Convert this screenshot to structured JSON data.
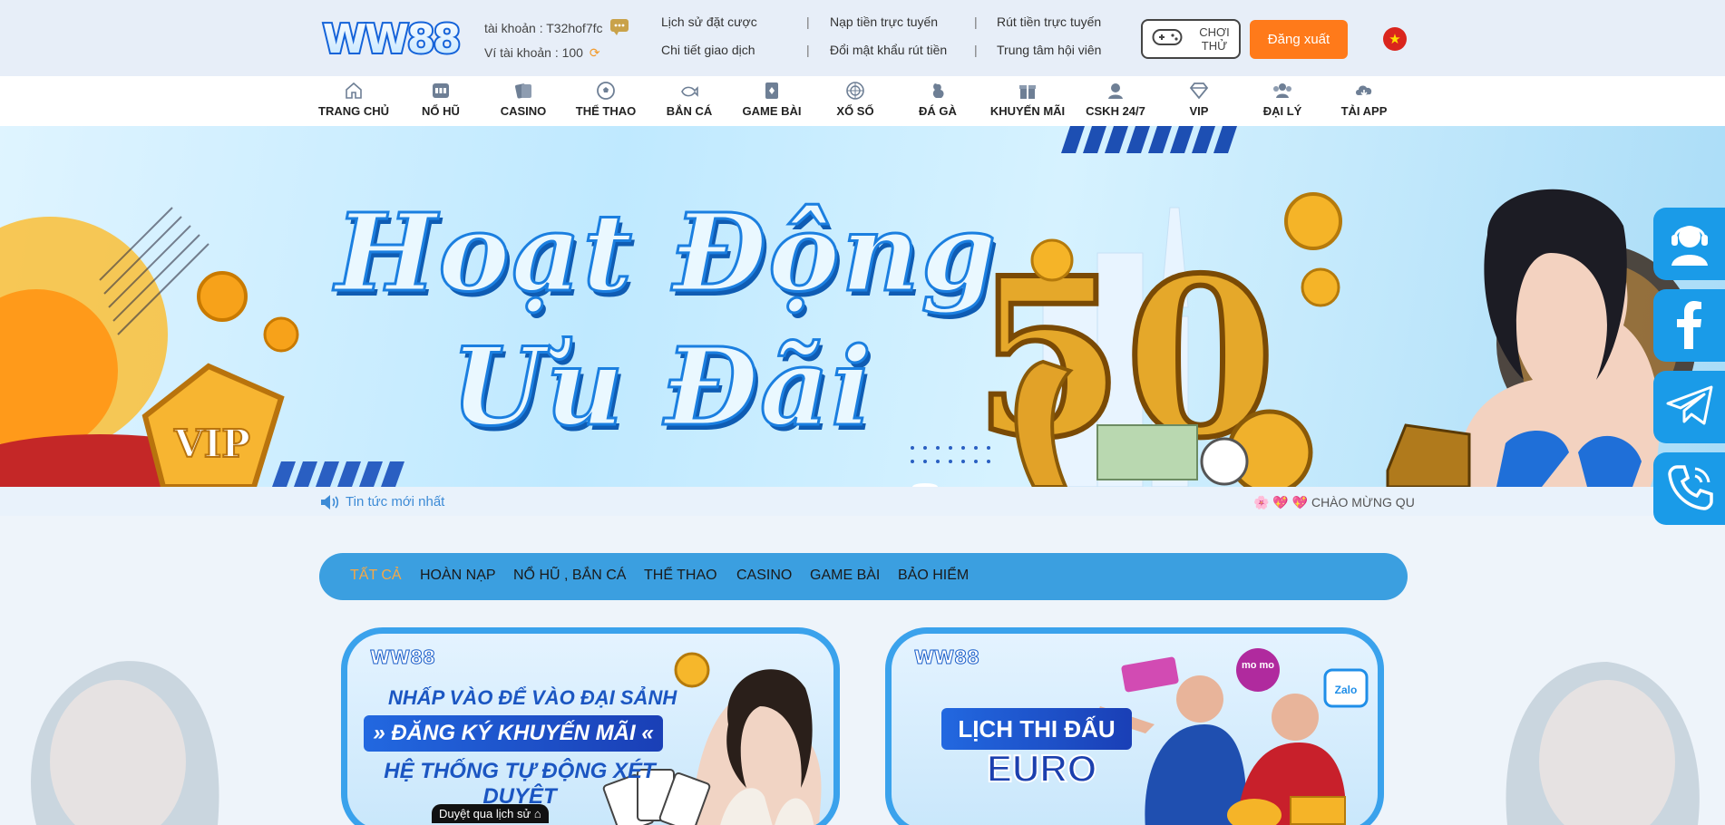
{
  "topbar": {
    "logo_text": "WW88",
    "account_label": "tài khoản : T32hof7fc",
    "wallet_label": "Ví tài khoản : 100",
    "links": [
      "Lịch sử đặt cược",
      "Nạp tiền trực tuyến",
      "Rút tiền trực tuyến",
      "Chi tiết giao dịch",
      "Đổi mật khẩu rút tiền",
      "Trung tâm hội viên"
    ],
    "separator": "|",
    "play_label_1": "CHƠI",
    "play_label_2": "THỬ",
    "logout_label": "Đăng xuất",
    "flag_star": "★"
  },
  "nav": {
    "items": [
      {
        "label": "TRANG CHỦ",
        "icon": "home-icon"
      },
      {
        "label": "NỔ HŨ",
        "icon": "slot-icon"
      },
      {
        "label": "CASINO",
        "icon": "cards-icon"
      },
      {
        "label": "THỂ THAO",
        "icon": "soccer-ball-icon"
      },
      {
        "label": "BẮN CÁ",
        "icon": "fish-icon"
      },
      {
        "label": "GAME BÀI",
        "icon": "card-game-icon"
      },
      {
        "label": "XỔ SỐ",
        "icon": "lottery-icon"
      },
      {
        "label": "ĐÁ GÀ",
        "icon": "rooster-icon"
      },
      {
        "label": "KHUYẾN MÃI",
        "icon": "gift-icon"
      },
      {
        "label": "CSKH 24/7",
        "icon": "support-icon"
      },
      {
        "label": "VIP",
        "icon": "diamond-icon"
      },
      {
        "label": "ĐẠI LÝ",
        "icon": "agent-icon"
      },
      {
        "label": "TẢI APP",
        "icon": "download-icon"
      }
    ]
  },
  "banner": {
    "title_line1": "Hoạt Động",
    "title_line2": "Ưu Đãi",
    "vip_badge": "VIP",
    "big_number": "50"
  },
  "news": {
    "label": "Tin tức mới nhất",
    "marquee": "🌸 💖 💖 CHÀO MỪNG QU"
  },
  "categories": {
    "items": [
      "TẤT CẢ",
      "HOÀN NẠP",
      "NỔ HŨ , BẮN CÁ",
      "THỂ THAO",
      "CASINO",
      "GAME BÀI",
      "BẢO HIỂM"
    ],
    "active_index": 0
  },
  "side": {
    "items": [
      "support-agent-icon",
      "facebook-icon",
      "telegram-icon",
      "phone-icon"
    ]
  },
  "cards": [
    {
      "logo": "WW88",
      "line1": "NHẤP VÀO ĐỂ VÀO ĐẠI SẢNH",
      "line2": "» ĐĂNG KÝ KHUYẾN MÃI «",
      "line3": "HỆ THỐNG TỰ ĐỘNG XÉT DUYỆT",
      "history_tab": "Duyệt qua lịch sử"
    },
    {
      "logo": "WW88",
      "line1": "LỊCH THI ĐẤU",
      "line2": "EURO",
      "badge_momo": "mo mo",
      "badge_zalo": "Zalo"
    }
  ],
  "colors": {
    "accent": "#3b9fe0",
    "logout": "#ff7a1a",
    "active_category": "#f7a844"
  }
}
